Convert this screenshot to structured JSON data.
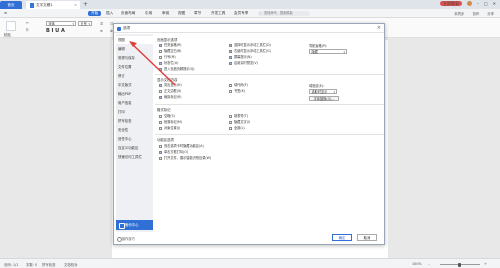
{
  "window": {
    "home_tab": "首页",
    "doc_tab": "文字文稿1",
    "new_tab": "+",
    "login_badge": "立即登录",
    "min": "–",
    "max": "□",
    "close": "✕"
  },
  "ribbon_tabs": [
    "开始",
    "插入",
    "页面布局",
    "引用",
    "审阅",
    "视图",
    "章节",
    "开发工具",
    "会员专享"
  ],
  "ribbon_search": "查找命令、搜索模板",
  "ribbon_right": [
    "未同步",
    "协作",
    "分享"
  ],
  "ribbon": {
    "paste": "粘贴",
    "font_size": "五号",
    "font_name": "宋体",
    "format_marks": "B I U A"
  },
  "dialog": {
    "title": "选项",
    "side_items": [
      "视图",
      "编辑",
      "常规与保存",
      "文件位置",
      "修订",
      "中文版式",
      "输出PDF",
      "用户信息",
      "打印",
      "拼写检查",
      "安全性",
      "信任中心",
      "自定义功能区",
      "快速访问工具栏"
    ],
    "backup_button": "备份中心",
    "tips_link": "操作技巧",
    "ok_button": "确定",
    "cancel_button": "取消",
    "group1": {
      "title": "页面显示选项",
      "col1": [
        {
          "label": "任务窗格(R)",
          "checked": true
        },
        {
          "label": "隐藏空白(B)",
          "checked": false
        },
        {
          "label": "行号(M)",
          "checked": false
        },
        {
          "label": "状态栏(U)",
          "checked": true
        },
        {
          "label": "进入页眉页脚提示(Q)",
          "checked": true
        }
      ],
      "col2": [
        {
          "label": "选择时显示浮动工具栏(D)",
          "checked": true
        },
        {
          "label": "右键时显示浮动工具栏(G)",
          "checked": true
        },
        {
          "label": "屏幕提示(N)",
          "checked": true
        },
        {
          "label": "启用实时预览(V)",
          "checked": true
        }
      ],
      "nav_label": "导航窗格(P):",
      "nav_value": "隐藏"
    },
    "group2": {
      "title": "显示文档内容",
      "col1": [
        {
          "label": "突出显示(H)",
          "checked": true
        },
        {
          "label": "正文边框(X)",
          "checked": false
        },
        {
          "label": "裁剪标记(R)",
          "checked": true
        }
      ],
      "col2": [
        {
          "label": "域代码(F)",
          "checked": false
        },
        {
          "label": "书签(K)",
          "checked": false
        }
      ],
      "field_label": "域底纹(E):",
      "field_value": "选取时显示",
      "font_button": "字体替换(O)..."
    },
    "group3": {
      "title": "格式标记",
      "col1": [
        {
          "label": "空格(S)",
          "checked": false
        },
        {
          "label": "段落标记(M)",
          "checked": false
        },
        {
          "label": "对象位置(J)",
          "checked": false
        }
      ],
      "col2": [
        {
          "label": "制表符(T)",
          "checked": false
        },
        {
          "label": "隐藏文字(I)",
          "checked": false
        },
        {
          "label": "全部(L)",
          "checked": false
        }
      ]
    },
    "group4": {
      "title": "功能区选项",
      "items": [
        {
          "label": "双击选项卡时隐藏功能区(A)",
          "checked": false
        },
        {
          "label": "单击方框打勾(O)",
          "checked": true
        },
        {
          "label": "打开文件，展示智能识别目录(W)",
          "checked": false
        }
      ]
    }
  },
  "statusbar": {
    "page": "页码: 1/1",
    "words": "字数: 0",
    "spell": "拼写检查",
    "proof": "文档校对",
    "zoom": "100%"
  },
  "colors": {
    "accent": "#2f6fd6",
    "arrow": "#e03c3c"
  }
}
